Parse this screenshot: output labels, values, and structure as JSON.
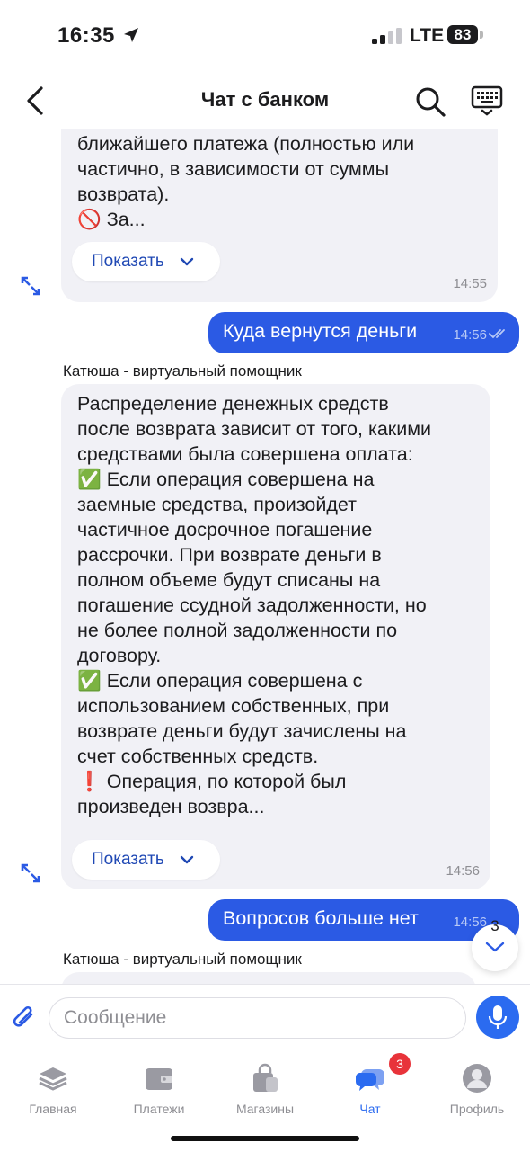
{
  "status_bar": {
    "time": "16:35",
    "network": "LTE",
    "battery": "83"
  },
  "header": {
    "title": "Чат с банком"
  },
  "messages": {
    "m1": {
      "text": "ближайшего платежа (полностью или\nчастично, в зависимости от суммы\nвозврата).\n🚫 За...",
      "show_label": "Показать",
      "time": "14:55"
    },
    "m2": {
      "text": "Куда вернутся деньги",
      "time": "14:56"
    },
    "m3": {
      "sender": "Катюша - виртуальный помощник",
      "text": "Распределение денежных средств\nпосле возврата зависит от того, какими\nсредствами была совершена оплата:\n✅ Если операция совершена на\nзаемные средства, произойдет\nчастичное досрочное погашение\nрассрочки. При возврате деньги в\nполном объеме будут списаны на\nпогашение ссудной задолженности, но\nне более полной задолженности по\nдоговору.\n✅ Если операция совершена с\nиспользованием собственных, при\nвозврате деньги будут зачислены на\nсчет собственных средств.\n❗ Операция, по которой был\nпроизведен возвра...",
      "show_label": "Показать",
      "time": "14:56"
    },
    "m4": {
      "text": "Вопросов больше нет",
      "time": "14:56"
    },
    "m5": {
      "sender": "Катюша - виртуальный помощник"
    }
  },
  "scroll_down": {
    "count": "3"
  },
  "input": {
    "placeholder": "Сообщение"
  },
  "tabs": {
    "home": "Главная",
    "payments": "Платежи",
    "shops": "Магазины",
    "chat": "Чат",
    "chat_badge": "3",
    "profile": "Профиль"
  },
  "colors": {
    "accent": "#2b5ae4",
    "badge": "#e8333a",
    "incoming_bubble": "#f1f1f6"
  }
}
